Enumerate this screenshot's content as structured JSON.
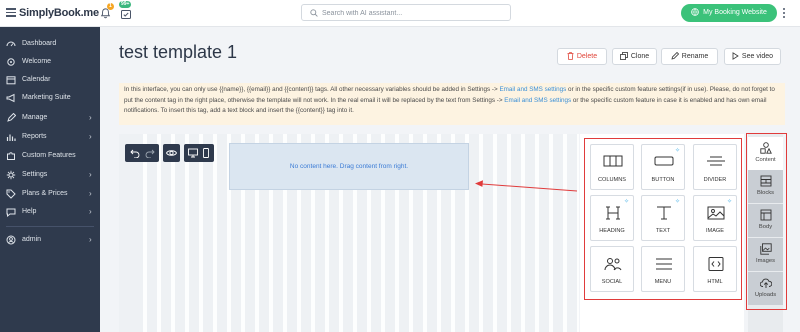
{
  "app": {
    "logo_text": "SimplyBook.me",
    "notif_badge": "1",
    "cal_badge": "99+"
  },
  "search": {
    "placeholder": "Search with AI assistant..."
  },
  "header_action": {
    "label": "My Booking Website"
  },
  "sidebar": {
    "items": [
      {
        "label": "Dashboard",
        "icon": "dashboard-icon"
      },
      {
        "label": "Welcome",
        "icon": "gear-icon"
      },
      {
        "label": "Calendar",
        "icon": "calendar-icon"
      },
      {
        "label": "Marketing Suite",
        "icon": "megaphone-icon"
      },
      {
        "label": "Manage",
        "icon": "edit-icon",
        "chevron": "›"
      },
      {
        "label": "Reports",
        "icon": "chart-icon",
        "chevron": "›"
      },
      {
        "label": "Custom Features",
        "icon": "puzzle-icon"
      },
      {
        "label": "Settings",
        "icon": "settings-icon",
        "chevron": "›"
      },
      {
        "label": "Plans & Prices",
        "icon": "tag-icon",
        "chevron": "›"
      },
      {
        "label": "Help",
        "icon": "chat-icon",
        "chevron": "›"
      }
    ],
    "user": {
      "label": "admin",
      "icon": "user-icon",
      "chevron": "›"
    }
  },
  "page": {
    "title": "test template 1",
    "buttons": {
      "delete": "Delete",
      "clone": "Clone",
      "rename": "Rename",
      "video": "See video"
    }
  },
  "note": {
    "part1": "In this interface, you can only use {{name}}, {{email}} and {{content}} tags. All other necessary variables should be added in Settings -> ",
    "link1": "Email and SMS settings",
    "part2": " or in the specific custom feature settings(if in use). Please, do not forget to put the content tag in the right place, otherwise the template will not work. In the real email it will be replaced by the text from Settings -> ",
    "link2": "Email and SMS settings",
    "part3": " or the specific custom feature in case it is enabled and has own email notifications. To insert this tag, add a text block and insert the {{content}} tag into it."
  },
  "editor": {
    "dropzone_text": "No content here. Drag content from right."
  },
  "content_blocks": [
    {
      "label": "COLUMNS",
      "icon": "columns-icon",
      "spark": false
    },
    {
      "label": "BUTTON",
      "icon": "button-icon",
      "spark": true
    },
    {
      "label": "DIVIDER",
      "icon": "divider-icon",
      "spark": false
    },
    {
      "label": "HEADING",
      "icon": "heading-icon",
      "spark": true
    },
    {
      "label": "TEXT",
      "icon": "text-icon",
      "spark": true
    },
    {
      "label": "IMAGE",
      "icon": "image-icon",
      "spark": true
    },
    {
      "label": "SOCIAL",
      "icon": "social-icon",
      "spark": false
    },
    {
      "label": "MENU",
      "icon": "menu-icon",
      "spark": false
    },
    {
      "label": "HTML",
      "icon": "html-icon",
      "spark": false
    }
  ],
  "side_tabs": [
    {
      "label": "Content",
      "icon": "shapes-icon",
      "active": true
    },
    {
      "label": "Blocks",
      "icon": "blocks-icon"
    },
    {
      "label": "Body",
      "icon": "body-icon"
    },
    {
      "label": "Images",
      "icon": "images-icon"
    },
    {
      "label": "Uploads",
      "icon": "upload-icon"
    }
  ],
  "colors": {
    "sidebar_bg": "#2f3a4d",
    "accent_green": "#3bc27a",
    "link_blue": "#3a8fd6",
    "highlight_red": "#e03b3b"
  }
}
